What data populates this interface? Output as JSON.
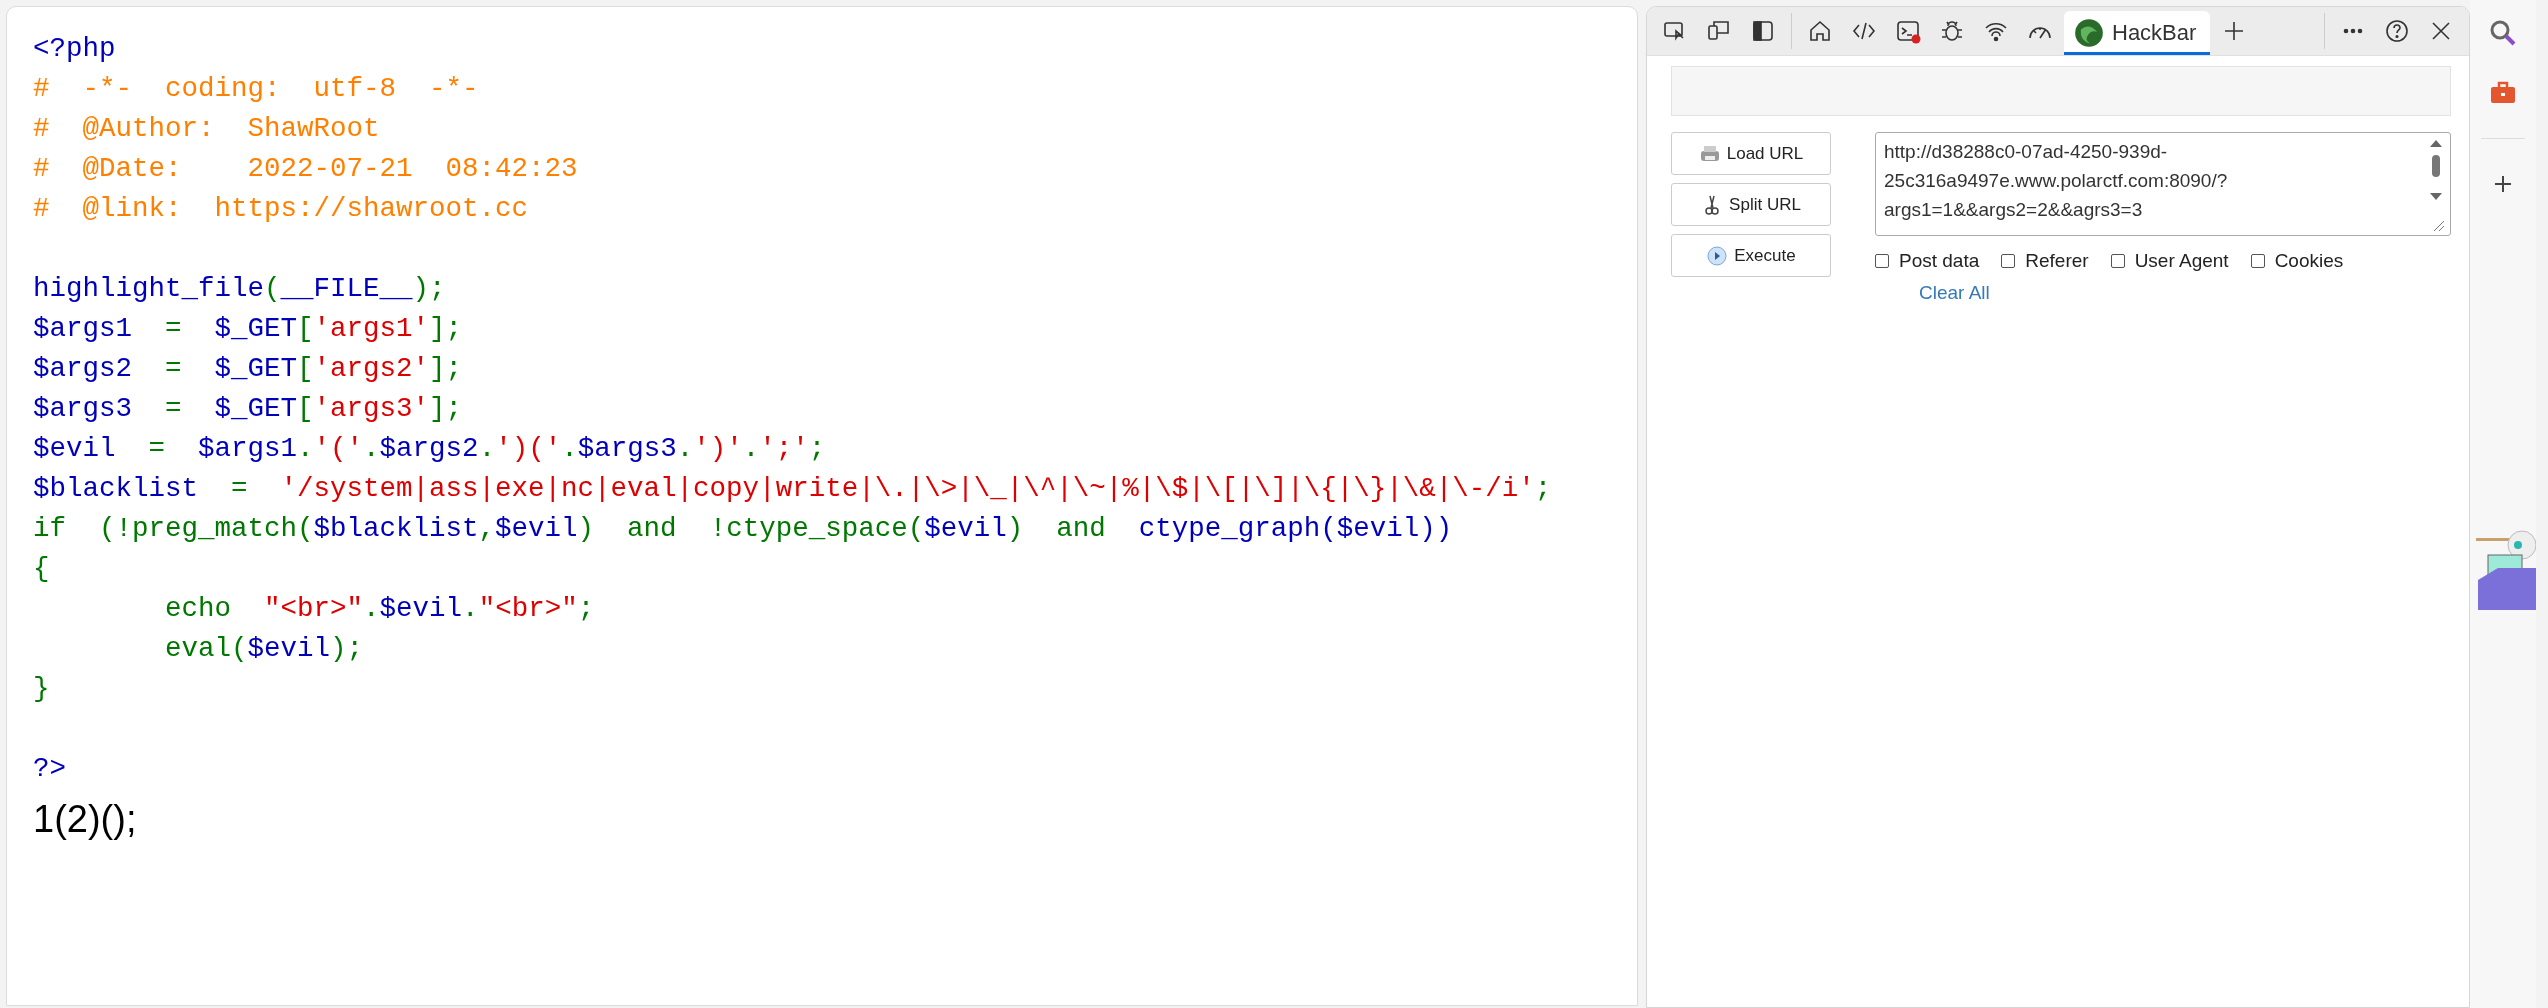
{
  "source": {
    "lines": [
      {
        "kind": "code",
        "tokens": [
          {
            "kind": "default",
            "text": "<?php"
          }
        ]
      },
      {
        "kind": "code",
        "tokens": [
          {
            "kind": "comment",
            "text": "#  -*-  coding:  utf-8  -*-"
          }
        ]
      },
      {
        "kind": "code",
        "tokens": [
          {
            "kind": "comment",
            "text": "#  @Author:  ShawRoot"
          }
        ]
      },
      {
        "kind": "code",
        "tokens": [
          {
            "kind": "comment",
            "text": "#  @Date:    2022-07-21  08:42:23"
          }
        ]
      },
      {
        "kind": "code",
        "tokens": [
          {
            "kind": "comment",
            "text": "#  @link:  https://shawroot.cc"
          }
        ]
      },
      {
        "kind": "blank"
      },
      {
        "kind": "code",
        "tokens": [
          {
            "kind": "default",
            "text": "highlight_file"
          },
          {
            "kind": "keyword",
            "text": "("
          },
          {
            "kind": "default",
            "text": "__FILE__"
          },
          {
            "kind": "keyword",
            "text": ");"
          }
        ]
      },
      {
        "kind": "code",
        "tokens": [
          {
            "kind": "default",
            "text": "$args1"
          },
          {
            "kind": "keyword",
            "text": "  =  "
          },
          {
            "kind": "default",
            "text": "$_GET"
          },
          {
            "kind": "keyword",
            "text": "["
          },
          {
            "kind": "string",
            "text": "'args1'"
          },
          {
            "kind": "keyword",
            "text": "];"
          }
        ]
      },
      {
        "kind": "code",
        "tokens": [
          {
            "kind": "default",
            "text": "$args2"
          },
          {
            "kind": "keyword",
            "text": "  =  "
          },
          {
            "kind": "default",
            "text": "$_GET"
          },
          {
            "kind": "keyword",
            "text": "["
          },
          {
            "kind": "string",
            "text": "'args2'"
          },
          {
            "kind": "keyword",
            "text": "];"
          }
        ]
      },
      {
        "kind": "code",
        "tokens": [
          {
            "kind": "default",
            "text": "$args3"
          },
          {
            "kind": "keyword",
            "text": "  =  "
          },
          {
            "kind": "default",
            "text": "$_GET"
          },
          {
            "kind": "keyword",
            "text": "["
          },
          {
            "kind": "string",
            "text": "'args3'"
          },
          {
            "kind": "keyword",
            "text": "];"
          }
        ]
      },
      {
        "kind": "code",
        "tokens": [
          {
            "kind": "default",
            "text": "$evil"
          },
          {
            "kind": "keyword",
            "text": "  =  "
          },
          {
            "kind": "default",
            "text": "$args1"
          },
          {
            "kind": "keyword",
            "text": "."
          },
          {
            "kind": "string",
            "text": "'('"
          },
          {
            "kind": "keyword",
            "text": "."
          },
          {
            "kind": "default",
            "text": "$args2"
          },
          {
            "kind": "keyword",
            "text": "."
          },
          {
            "kind": "string",
            "text": "')('"
          },
          {
            "kind": "keyword",
            "text": "."
          },
          {
            "kind": "default",
            "text": "$args3"
          },
          {
            "kind": "keyword",
            "text": "."
          },
          {
            "kind": "string",
            "text": "')'"
          },
          {
            "kind": "keyword",
            "text": "."
          },
          {
            "kind": "string",
            "text": "';'"
          },
          {
            "kind": "keyword",
            "text": ";"
          }
        ]
      },
      {
        "kind": "code",
        "tokens": [
          {
            "kind": "default",
            "text": "$blacklist"
          },
          {
            "kind": "keyword",
            "text": "  =  "
          },
          {
            "kind": "string",
            "text": "'/system|ass|exe|nc|eval|copy|write|\\.|\\>|\\_|\\^|\\~|%|\\$|\\[|\\]|\\{|\\}|\\&|\\-/i'"
          },
          {
            "kind": "keyword",
            "text": ";"
          }
        ]
      },
      {
        "kind": "code",
        "tokens": [
          {
            "kind": "keyword",
            "text": "if  (!preg_match("
          },
          {
            "kind": "default",
            "text": "$blacklist"
          },
          {
            "kind": "keyword",
            "text": ","
          },
          {
            "kind": "default",
            "text": "$evil"
          },
          {
            "kind": "keyword",
            "text": ")  and  !ctype_space("
          },
          {
            "kind": "default",
            "text": "$evil"
          },
          {
            "kind": "keyword",
            "text": ")  and  "
          },
          {
            "kind": "default",
            "text": "ctype_graph($evil))"
          }
        ]
      },
      {
        "kind": "code",
        "tokens": [
          {
            "kind": "keyword",
            "text": "{"
          }
        ]
      },
      {
        "kind": "code",
        "tokens": [
          {
            "kind": "keyword",
            "text": "        echo  "
          },
          {
            "kind": "string",
            "text": "\"<br>\""
          },
          {
            "kind": "keyword",
            "text": "."
          },
          {
            "kind": "default",
            "text": "$evil"
          },
          {
            "kind": "keyword",
            "text": "."
          },
          {
            "kind": "string",
            "text": "\"<br>\""
          },
          {
            "kind": "keyword",
            "text": ";"
          }
        ]
      },
      {
        "kind": "code",
        "tokens": [
          {
            "kind": "keyword",
            "text": "        eval("
          },
          {
            "kind": "default",
            "text": "$evil"
          },
          {
            "kind": "keyword",
            "text": ");"
          }
        ]
      },
      {
        "kind": "code",
        "tokens": [
          {
            "kind": "keyword",
            "text": "}"
          }
        ]
      },
      {
        "kind": "blank"
      },
      {
        "kind": "code",
        "tokens": [
          {
            "kind": "default",
            "text": "?>"
          }
        ]
      }
    ],
    "output": "1(2)();"
  },
  "devtools": {
    "tools": [
      {
        "kind": "inspect",
        "selected": false
      },
      {
        "kind": "device",
        "selected": false
      },
      {
        "kind": "dock",
        "selected": false
      },
      {
        "kind": "home",
        "selected": false
      },
      {
        "kind": "elements",
        "selected": false
      },
      {
        "kind": "console",
        "selected": false,
        "error": true
      },
      {
        "kind": "bug",
        "selected": false
      },
      {
        "kind": "network",
        "selected": false
      },
      {
        "kind": "performance",
        "selected": false
      },
      {
        "kind": "tab",
        "label": "HackBar",
        "selected": true
      }
    ]
  },
  "hackbar": {
    "buttons": [
      {
        "kind": "load",
        "label": "Load URL"
      },
      {
        "kind": "split",
        "label": "Split URL"
      },
      {
        "kind": "execute",
        "label": "Execute"
      }
    ],
    "url": "http://d38288c0-07ad-4250-939d-25c316a9497e.www.polarctf.com:8090/?args1=1&&args2=2&&agrs3=3",
    "options": [
      {
        "label": "Post data",
        "checked": false
      },
      {
        "label": "Referer",
        "checked": false
      },
      {
        "label": "User Agent",
        "checked": false
      },
      {
        "label": "Cookies",
        "checked": false
      }
    ],
    "clear": "Clear All"
  }
}
